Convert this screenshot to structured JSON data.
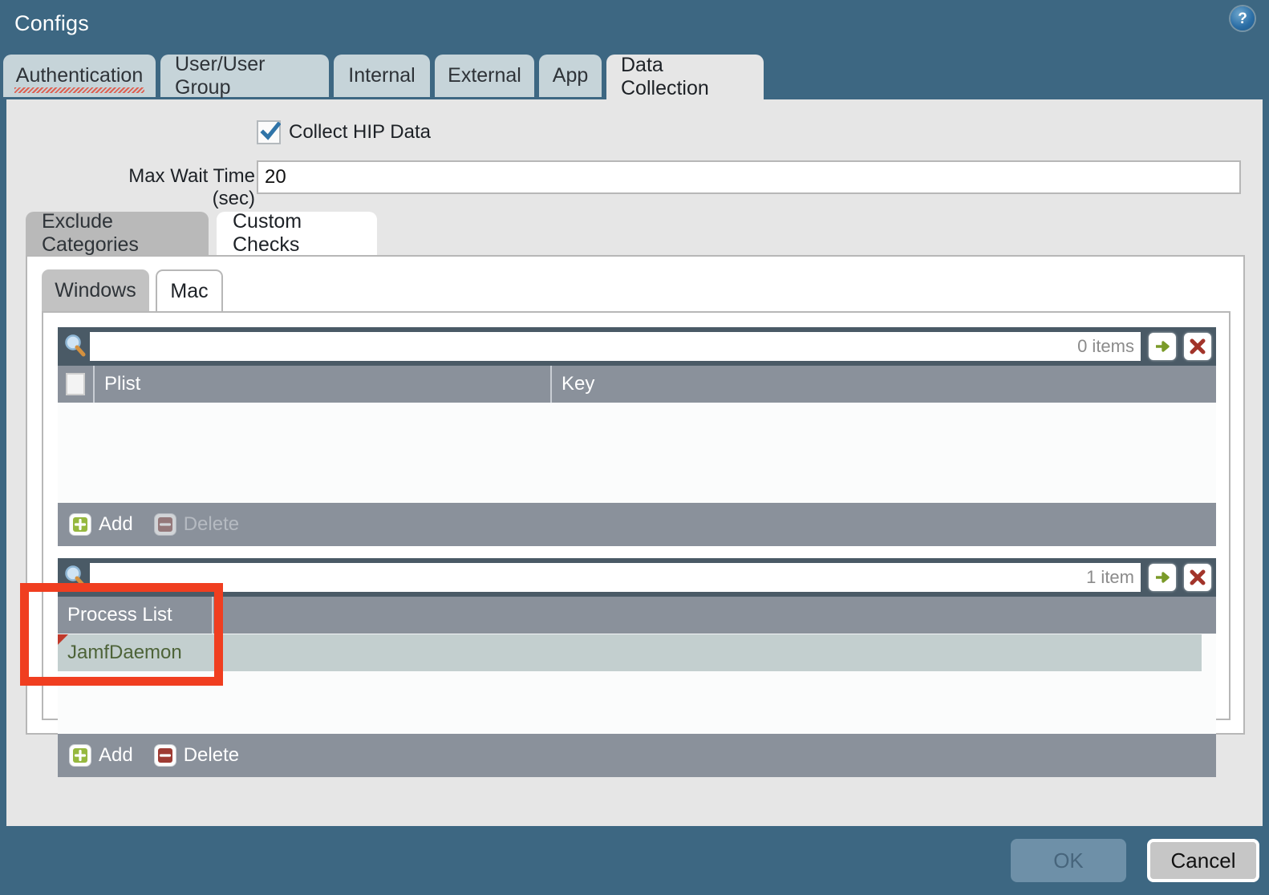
{
  "window": {
    "title": "Configs",
    "help_icon": "help-circle-icon",
    "help_glyph": "?"
  },
  "tabs": [
    {
      "label": "Authentication",
      "active": false,
      "misspelled": true
    },
    {
      "label": "User/User Group",
      "active": false
    },
    {
      "label": "Internal",
      "active": false
    },
    {
      "label": "External",
      "active": false
    },
    {
      "label": "App",
      "active": false
    },
    {
      "label": "Data Collection",
      "active": true
    }
  ],
  "data_collection": {
    "collect_hip": {
      "label": "Collect HIP Data",
      "checked": true
    },
    "max_wait": {
      "label": "Max Wait Time (sec)",
      "value": "20",
      "placeholder": ""
    },
    "inner_tabs": [
      {
        "label": "Exclude Categories",
        "active": false
      },
      {
        "label": "Custom Checks",
        "active": true
      }
    ],
    "os_tabs": [
      {
        "label": "Windows",
        "active": false
      },
      {
        "label": "Mac",
        "active": true
      }
    ],
    "lists": [
      {
        "name": "plist-table",
        "search_value": "",
        "search_placeholder": "",
        "count_label": "0 items",
        "columns": [
          "Plist",
          "Key"
        ],
        "rows": [],
        "add_label": "Add",
        "delete_label": "Delete",
        "delete_enabled": false,
        "apply_icon": "arrow-right-icon",
        "clear_icon": "close-x-icon",
        "search_icon": "search-icon"
      },
      {
        "name": "process-list-table",
        "search_value": "",
        "search_placeholder": "",
        "count_label": "1 item",
        "columns": [
          "Process List"
        ],
        "rows": [
          {
            "value": "JamfDaemon",
            "selected": true,
            "flagged": true
          }
        ],
        "add_label": "Add",
        "delete_label": "Delete",
        "delete_enabled": true,
        "apply_icon": "arrow-right-icon",
        "clear_icon": "close-x-icon",
        "search_icon": "search-icon"
      }
    ]
  },
  "footer": {
    "ok_label": "OK",
    "ok_enabled": false,
    "cancel_label": "Cancel"
  },
  "colors": {
    "chrome": "#3d6782",
    "panel": "#e6e6e6",
    "toolbar": "#4a5a66",
    "table_header": "#8a919b",
    "selected_row": "#c3cfcf",
    "row_text": "#4d6338",
    "annotation": "#f03e20"
  }
}
